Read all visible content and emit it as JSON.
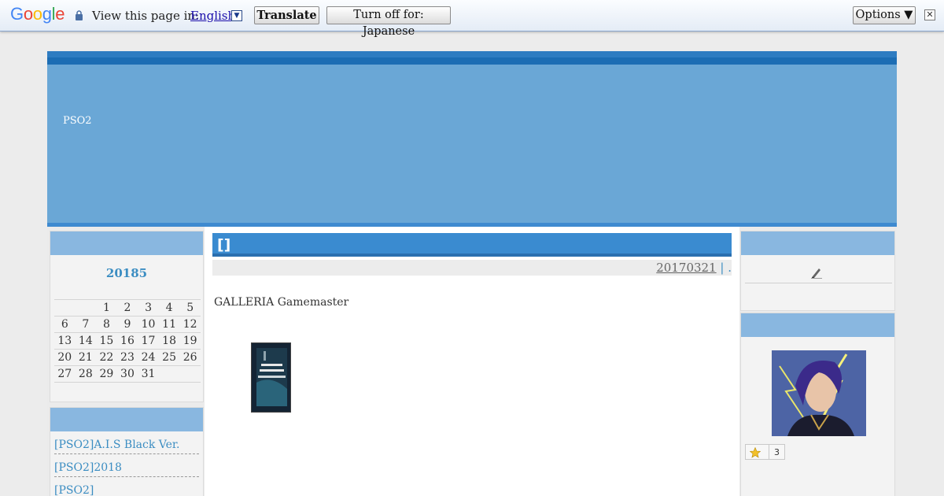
{
  "translate_bar": {
    "logo": "Google",
    "view_text": "View this page in:",
    "language": "English",
    "translate_label": "Translate",
    "turn_off_label": "Turn off for: Japanese",
    "options_label": "Options ▼",
    "close_glyph": "✕"
  },
  "header": {
    "site_title": "PSO2"
  },
  "calendar": {
    "title": "20185",
    "weeks": [
      [
        "",
        "",
        "1",
        "2",
        "3",
        "4",
        "5"
      ],
      [
        "6",
        "7",
        "8",
        "9",
        "10",
        "11",
        "12"
      ],
      [
        "13",
        "14",
        "15",
        "16",
        "17",
        "18",
        "19"
      ],
      [
        "20",
        "21",
        "22",
        "23",
        "24",
        "25",
        "26"
      ],
      [
        "27",
        "28",
        "29",
        "30",
        "31",
        "",
        ""
      ]
    ]
  },
  "categories": [
    "[PSO2]A.I.S Black Ver.",
    "[PSO2]2018",
    "[PSO2]"
  ],
  "post": {
    "title": "[]",
    "date": "20170321",
    "separator": " | ",
    "meta_tail": ".",
    "body": "GALLERIA Gamemaster"
  },
  "profile": {
    "star_count": "3"
  },
  "colors": {
    "accent": "#3a8bd0",
    "header": "#6aa7d6",
    "box_head": "#89b7e0",
    "link": "#3b8dc2"
  }
}
